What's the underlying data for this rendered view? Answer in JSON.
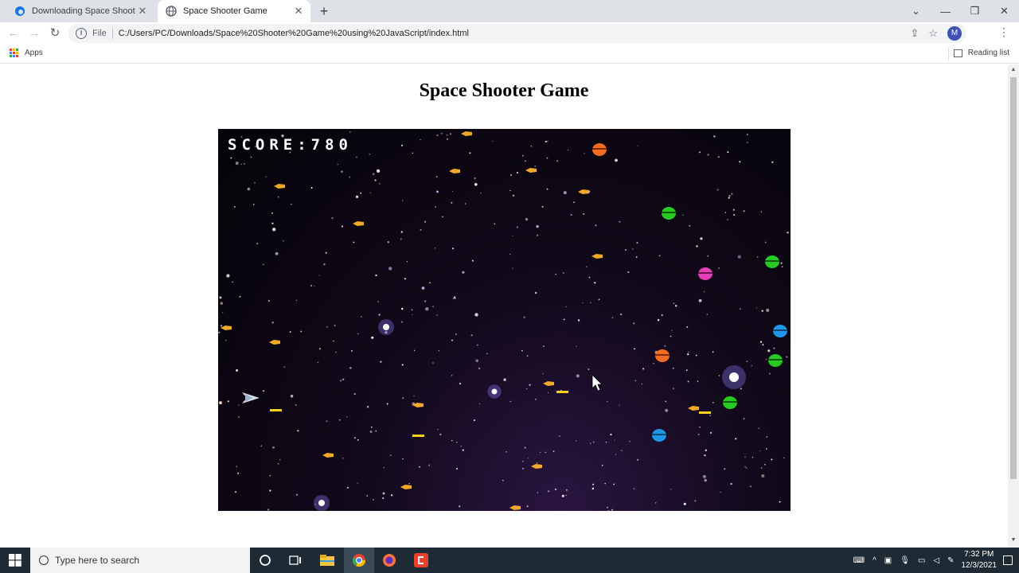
{
  "browser": {
    "tabs": [
      {
        "title": "Downloading Space Shooter Gam",
        "active": false
      },
      {
        "title": "Space Shooter Game",
        "active": true
      }
    ],
    "new_tab_symbol": "+",
    "address": {
      "scheme_label": "File",
      "url": "C:/Users/PC/Downloads/Space%20Shooter%20Game%20using%20JavaScript/index.html"
    },
    "profile_initial": "M",
    "bookmarks": {
      "apps_label": "Apps",
      "reading_list_label": "Reading list"
    }
  },
  "page": {
    "title": "Space Shooter Game",
    "game": {
      "score_label": "SCORE:",
      "score_value": "780"
    }
  },
  "taskbar": {
    "search_placeholder": "Type here to search",
    "time": "7:32 PM",
    "date": "12/3/2021"
  },
  "icons": [
    "windows-logo-icon",
    "search-icon",
    "cortana-icon",
    "task-view-icon",
    "file-explorer-icon",
    "chrome-icon",
    "firefox-icon",
    "app-icon",
    "reload-icon",
    "back-icon",
    "forward-icon",
    "share-icon",
    "star-icon",
    "apps-grid-icon",
    "reading-list-icon"
  ],
  "colors": {
    "tab_strip": "#dee1e6",
    "game_bg": "#050308",
    "taskbar": "#1f2b34",
    "enemy_colors": [
      "#f26c22",
      "#29c924",
      "#e33fb7",
      "#2196e8"
    ],
    "bullet_color": "#f2a92a",
    "laser_color": "#f5d020"
  }
}
